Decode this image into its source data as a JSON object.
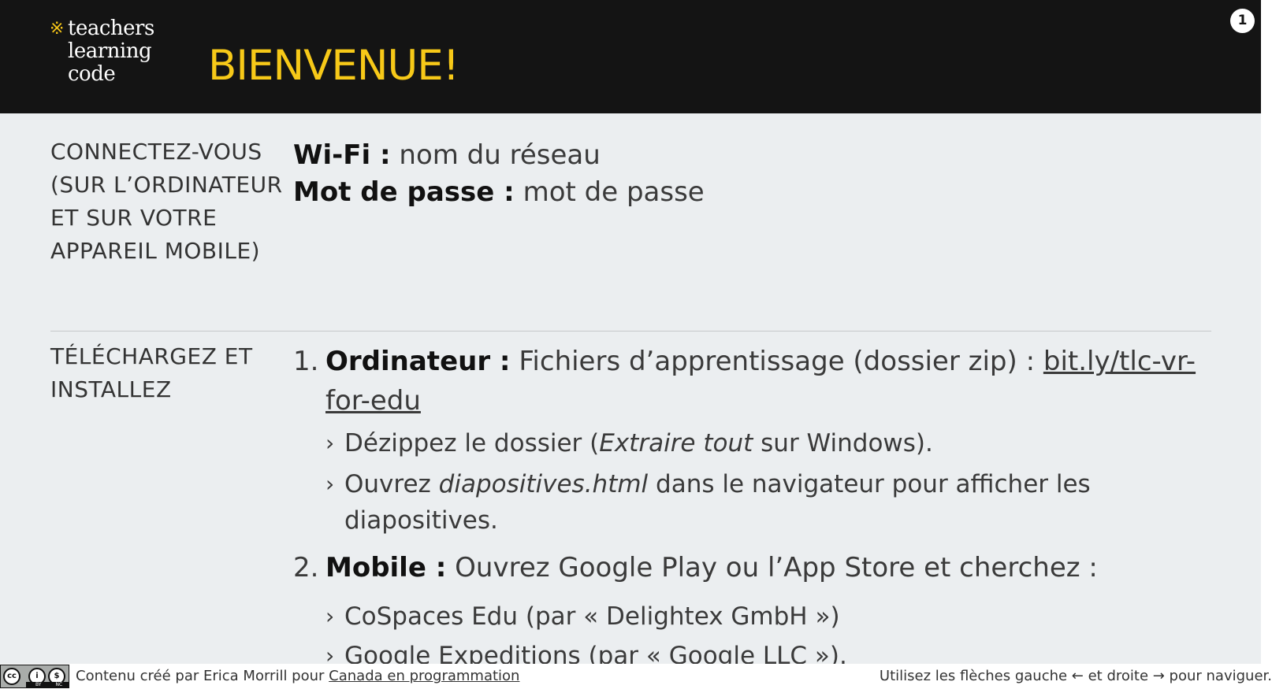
{
  "header": {
    "logo_lines": [
      "teachers",
      "learning",
      "code"
    ],
    "logo_mark": "※",
    "title": "BIENVENUE!",
    "slide_number": "1"
  },
  "connect": {
    "label": "CONNECTEZ-VOUS (SUR L’ORDINATEUR ET SUR VOTRE APPAREIL MOBILE)",
    "wifi_key": "Wi-Fi :",
    "wifi_value": "nom du réseau",
    "password_key": "Mot de passe :",
    "password_value": "mot de passe"
  },
  "download": {
    "label": "TÉLÉCHARGEZ ET INSTALLEZ",
    "step1_num": "1.",
    "step1_key": "Ordinateur :",
    "step1_text": "Fichiers d’apprentissage (dossier zip) :",
    "step1_link": "bit.ly/tlc-vr-for-edu",
    "step1_sub1_a": "Dézippez le dossier (",
    "step1_sub1_em": "Extraire tout",
    "step1_sub1_b": "sur Windows).",
    "step1_sub2_a": "Ouvrez",
    "step1_sub2_em": "diapositives.html",
    "step1_sub2_b": "dans le navigateur pour afficher les diapositives.",
    "step2_num": "2.",
    "step2_key": "Mobile :",
    "step2_text": "Ouvrez Google Play ou l’App Store et cherchez :",
    "step2_sub1": "CoSpaces Edu (par « Delightex GmbH »)",
    "step2_sub2": "Google Expeditions (par « Google LLC »).",
    "chevron": "›"
  },
  "footer": {
    "cc_by": "BY",
    "cc_nc": "NC",
    "credit_text": "Contenu créé par Erica Morrill pour",
    "credit_link": "Canada en programmation",
    "nav_hint": "Utilisez les flèches gauche ← et droite → pour naviguer."
  }
}
